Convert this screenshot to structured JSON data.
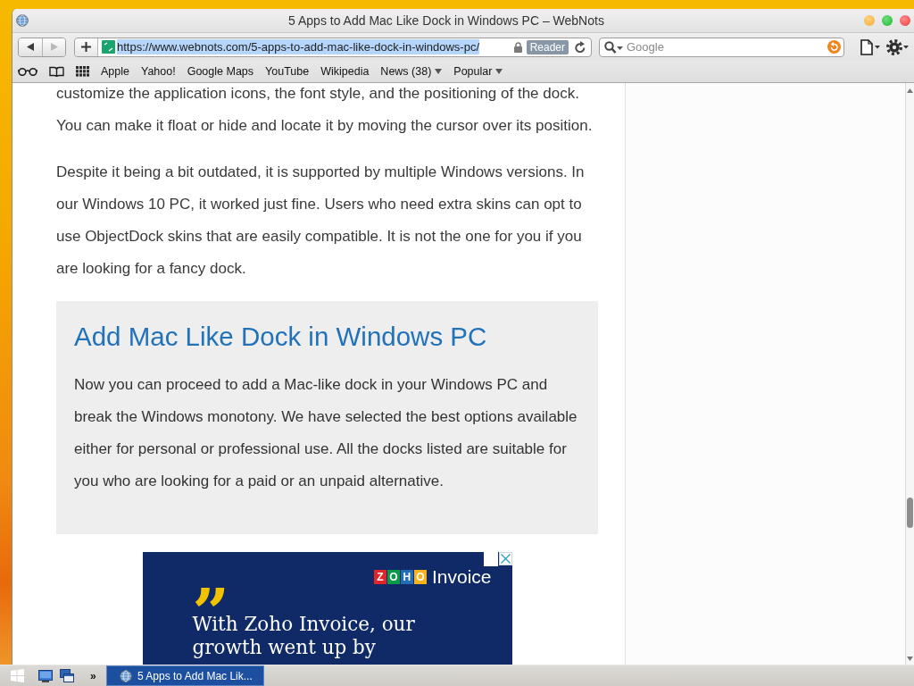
{
  "window": {
    "title": "5 Apps to Add Mac Like Dock in Windows PC – WebNots"
  },
  "toolbar": {
    "navigation": [
      {
        "kind": "back",
        "disabled": false
      },
      {
        "kind": "forward",
        "disabled": true
      }
    ],
    "address": {
      "url": "https://www.webnots.com/5-apps-to-add-mac-like-dock-in-windows-pc/",
      "selected": true,
      "reader": "Reader"
    },
    "search": {
      "placeholder": "Google"
    }
  },
  "bookmarks": [
    {
      "label": "Apple",
      "menu": false
    },
    {
      "label": "Yahoo!",
      "menu": false
    },
    {
      "label": "Google Maps",
      "menu": false
    },
    {
      "label": "YouTube",
      "menu": false
    },
    {
      "label": "Wikipedia",
      "menu": false
    },
    {
      "label": "News (38)",
      "menu": true
    },
    {
      "label": "Popular",
      "menu": true
    }
  ],
  "article": {
    "paragraphs": [
      {
        "lines": [
          "customize the application icons, the font style, and the positioning of the dock.",
          "You can make it float or hide and locate it by moving the cursor over its position."
        ]
      },
      {
        "lines": [
          "Despite it being a bit outdated, it is supported by multiple Windows versions. In",
          "our Windows 10 PC, it worked just fine. Users who need extra skins can opt to",
          "use ObjectDock skins that are easily compatible. It is not the one for you if you",
          "are looking for a fancy dock."
        ]
      }
    ],
    "callout": {
      "heading": "Add Mac Like Dock in Windows PC",
      "lines": [
        "Now you can proceed to add a Mac-like dock in your Windows PC and",
        "break the Windows monotony. We have selected the best options available",
        "either for personal or professional use. All the docks listed are suitable for",
        "you who are looking for a paid or an unpaid alternative."
      ]
    }
  },
  "ad": {
    "logo_tiles": [
      {
        "letter": "Z",
        "color": "#e42527"
      },
      {
        "letter": "O",
        "color": "#089949"
      },
      {
        "letter": "H",
        "color": "#226db4"
      },
      {
        "letter": "O",
        "color": "#f9b21d"
      }
    ],
    "brand": "Invoice",
    "quote_mark": "”",
    "lines": [
      "With Zoho Invoice, our",
      "growth went up by"
    ]
  },
  "taskbar": {
    "overflow": "»",
    "tasks": [
      {
        "label": "5 Apps to Add Mac Lik...",
        "selected": true
      }
    ]
  }
}
